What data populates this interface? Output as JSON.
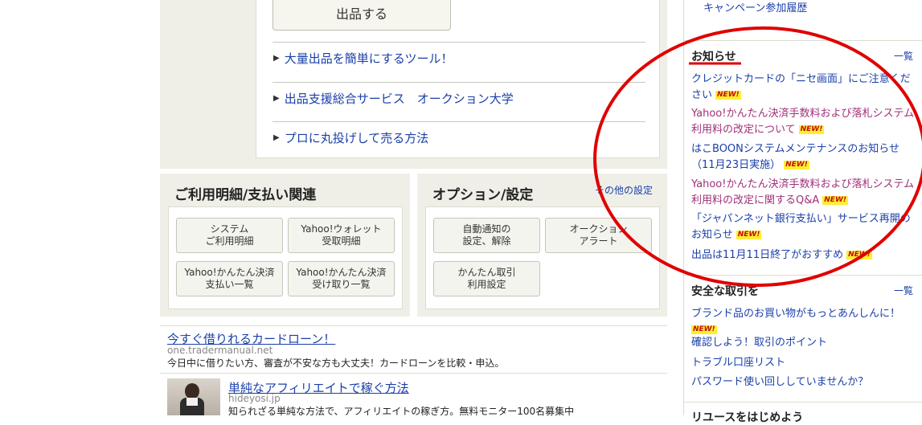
{
  "sell": {
    "button": "出品する",
    "links": [
      "大量出品を簡単にするツール！",
      "出品支援総合サービス　オークション大学",
      "プロに丸投げして売る方法"
    ]
  },
  "billing": {
    "title": "ご利用明細/支払い関連",
    "buttons": [
      "システム\nご利用明細",
      "Yahoo!ウォレット\n受取明細",
      "Yahoo!かんたん決済\n支払い一覧",
      "Yahoo!かんたん決済\n受け取り一覧"
    ]
  },
  "options": {
    "title": "オプション/設定",
    "other_link": "その他の設定",
    "buttons": [
      "自動通知の\n設定、解除",
      "オークション\nアラート",
      "かんたん取引\n利用設定"
    ]
  },
  "ads": [
    {
      "title": "今すぐ借りれるカードローン！",
      "url": "one.tradermanual.net",
      "desc": "今日中に借りたい方、審査が不安な方も大丈夫！カードローンを比較・申込。"
    },
    {
      "title": "単純なアフィリエイトで稼ぐ方法",
      "url": "hideyosi.jp",
      "desc": "知られざる単純な方法で、アフィリエイトの稼ぎ方。無料モニター100名募集中"
    }
  ],
  "right": {
    "campaign_link": "キャンペーン参加履歴",
    "news": {
      "title": "お知らせ",
      "more": "一覧",
      "items": [
        {
          "text": "クレジットカードの「ニセ画面」にご注意ください",
          "new": "NEW!",
          "color": "#1a3fa8"
        },
        {
          "text": "Yahoo!かんたん決済手数料および落札システム利用料の改定について",
          "new": "NEW!",
          "color": "#a0307a"
        },
        {
          "text": "はこBOONシステムメンテナンスのお知らせ（11月23日実施）",
          "new": "NEW!",
          "color": "#1a3fa8"
        },
        {
          "text": "Yahoo!かんたん決済手数料および落札システム利用料の改定に関するQ&A",
          "new": "NEW!",
          "color": "#a0307a"
        },
        {
          "text": "「ジャパンネット銀行支払い」サービス再開のお知らせ",
          "new": "NEW!",
          "color": "#1a3fa8"
        },
        {
          "text": "出品は11月11日終了がおすすめ",
          "new": "NEW!",
          "color": "#1a3fa8"
        }
      ]
    },
    "safe": {
      "title": "安全な取引を",
      "more": "一覧",
      "items": [
        {
          "text": "ブランド品のお買い物がもっとあんしんに！",
          "new": "NEW!"
        },
        {
          "text": "確認しよう！取引のポイント",
          "new": ""
        },
        {
          "text": "トラブル口座リスト",
          "new": ""
        },
        {
          "text": "パスワード使い回ししていませんか？",
          "new": ""
        }
      ]
    },
    "bottom_cut": "リユースをはじめよう"
  },
  "annotation": {
    "ellipse_color": "#e00000"
  }
}
